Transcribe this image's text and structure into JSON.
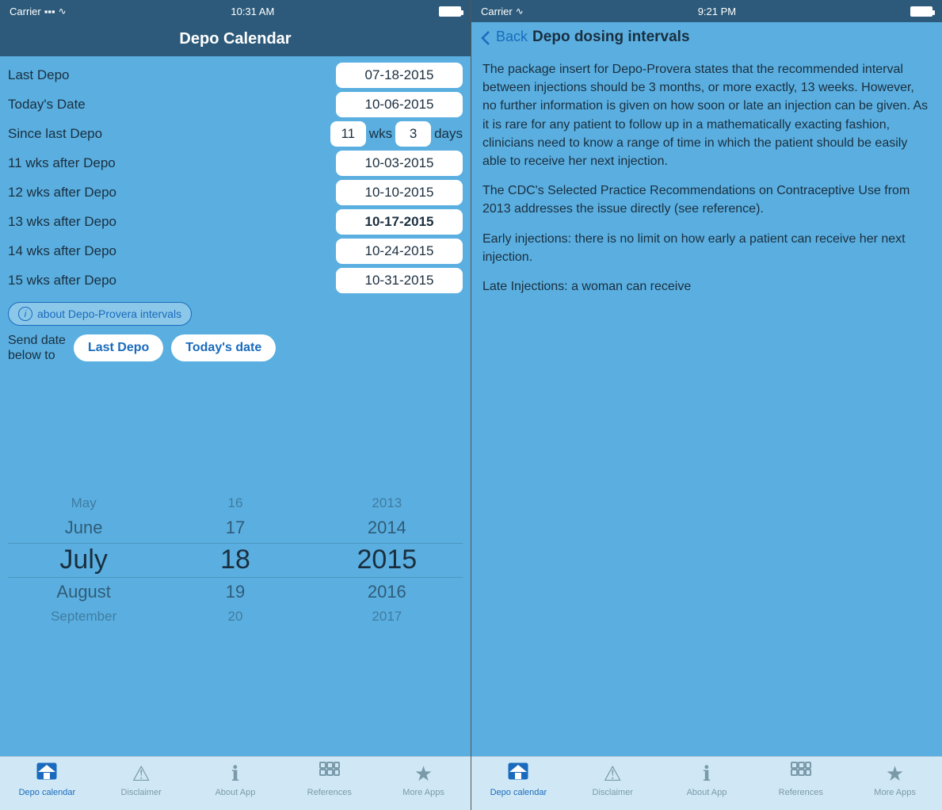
{
  "left_phone": {
    "status": {
      "carrier": "Carrier",
      "wifi": "📶",
      "time": "10:31 AM",
      "battery": ""
    },
    "header": {
      "title": "Depo Calendar"
    },
    "rows": [
      {
        "label": "Last Depo",
        "value": "07-18-2015",
        "bold": false
      },
      {
        "label": "Today's Date",
        "value": "10-06-2015",
        "bold": false
      }
    ],
    "since": {
      "label": "Since last Depo",
      "weeks": "11",
      "wks_label": "wks",
      "days": "3",
      "days_label": "days"
    },
    "week_rows": [
      {
        "label": "11 wks after Depo",
        "value": "10-03-2015",
        "bold": false
      },
      {
        "label": "12 wks after Depo",
        "value": "10-10-2015",
        "bold": false
      },
      {
        "label": "13 wks after Depo",
        "value": "10-17-2015",
        "bold": true
      },
      {
        "label": "14 wks after Depo",
        "value": "10-24-2015",
        "bold": false
      },
      {
        "label": "15 wks after Depo",
        "value": "10-31-2015",
        "bold": false
      }
    ],
    "info_btn": "about Depo-Provera intervals",
    "send_label": "Send date\nbelow to",
    "send_btn1": "Last Depo",
    "send_btn2": "Today's date",
    "picker": {
      "months": [
        "May",
        "June",
        "July",
        "August",
        "September"
      ],
      "days": [
        "16",
        "17",
        "18",
        "19",
        "20"
      ],
      "years": [
        "2013",
        "2014",
        "2015",
        "2016",
        "2017"
      ]
    },
    "tabs": [
      {
        "icon": "🏠",
        "label": "Depo calendar",
        "active": true
      },
      {
        "icon": "⚠",
        "label": "Disclaimer",
        "active": false
      },
      {
        "icon": "ℹ",
        "label": "About App",
        "active": false
      },
      {
        "icon": "📋",
        "label": "References",
        "active": false
      },
      {
        "icon": "★",
        "label": "More Apps",
        "active": false
      }
    ]
  },
  "right_phone": {
    "status": {
      "carrier": "Carrier",
      "wifi": "📶",
      "time": "9:21 PM",
      "battery": ""
    },
    "header": {
      "back": "Back",
      "title": "Depo dosing intervals"
    },
    "paragraphs": [
      "The package insert for Depo-Provera states that the recommended interval between injections should be 3 months, or more exactly, 13 weeks. However, no further information is given on how soon or late an injection can be given.  As it is rare for any patient to follow up in a mathematically exacting fashion, clinicians need to know a range of time in which the patient should be easily able to receive her next injection.",
      "The CDC's Selected Practice Recommendations on Contraceptive Use from 2013 addresses the issue directly (see reference).",
      "Early injections:  there is no limit on how early a patient can receive her next injection.",
      "Late Injections:  a woman can receive"
    ],
    "tabs": [
      {
        "icon": "🏠",
        "label": "Depo calendar",
        "active": true
      },
      {
        "icon": "⚠",
        "label": "Disclaimer",
        "active": false
      },
      {
        "icon": "ℹ",
        "label": "About App",
        "active": false
      },
      {
        "icon": "📋",
        "label": "References",
        "active": false
      },
      {
        "icon": "★",
        "label": "More Apps",
        "active": false
      }
    ]
  }
}
